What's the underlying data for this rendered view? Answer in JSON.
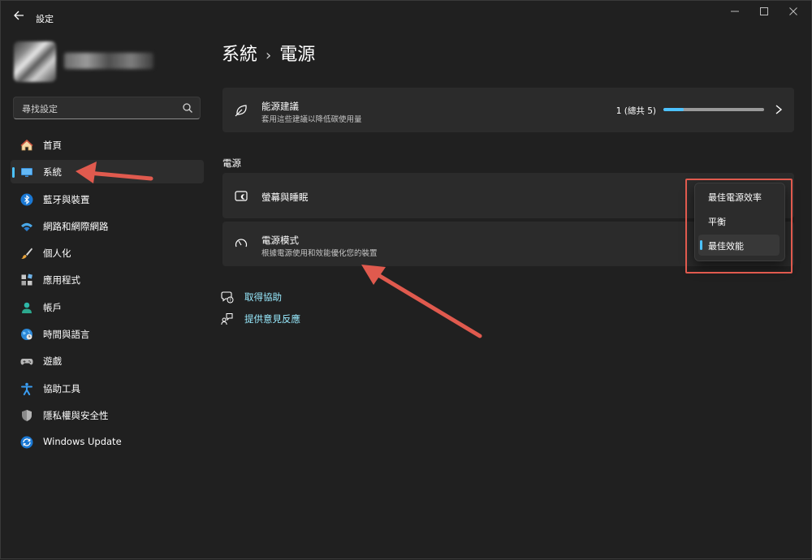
{
  "window": {
    "title": "設定",
    "back_icon": "back-arrow-icon",
    "controls": [
      "minimize-icon",
      "maximize-icon",
      "close-icon"
    ]
  },
  "search": {
    "placeholder": "尋找設定"
  },
  "sidebar": {
    "items": [
      {
        "label": "首頁",
        "icon": "home-icon"
      },
      {
        "label": "系統",
        "icon": "monitor-icon",
        "selected": true
      },
      {
        "label": "藍牙與裝置",
        "icon": "bluetooth-icon"
      },
      {
        "label": "網路和網際網路",
        "icon": "wifi-icon"
      },
      {
        "label": "個人化",
        "icon": "brush-icon"
      },
      {
        "label": "應用程式",
        "icon": "apps-icon"
      },
      {
        "label": "帳戶",
        "icon": "account-icon"
      },
      {
        "label": "時間與語言",
        "icon": "globe-clock-icon"
      },
      {
        "label": "遊戲",
        "icon": "gamepad-icon"
      },
      {
        "label": "協助工具",
        "icon": "accessibility-icon"
      },
      {
        "label": "隱私權與安全性",
        "icon": "shield-icon"
      },
      {
        "label": "Windows Update",
        "icon": "update-icon"
      }
    ]
  },
  "header": {
    "parent": "系統",
    "separator": "›",
    "current": "電源"
  },
  "energy_card": {
    "title": "能源建議",
    "subtitle": "套用這些建議以降低碳使用量",
    "progress_text": "1 (總共 5)",
    "progress_fraction": 0.2,
    "icon": "leaf-icon"
  },
  "power_section": {
    "title": "電源",
    "screen_sleep": {
      "title": "螢幕與睡眠",
      "icon": "screen-sleep-icon"
    },
    "power_mode": {
      "title": "電源模式",
      "subtitle": "根據電源使用和效能優化您的裝置",
      "icon": "speedometer-icon",
      "options": [
        "最佳電源效率",
        "平衡",
        "最佳效能"
      ],
      "selected_index": 2
    }
  },
  "links": [
    {
      "label": "取得協助",
      "icon": "help-chat-icon"
    },
    {
      "label": "提供意見反應",
      "icon": "feedback-icon"
    }
  ],
  "colors": {
    "accent": "#4cc2ff",
    "annotation": "#e05a4e",
    "background": "#202020",
    "card": "#2b2b2b"
  }
}
